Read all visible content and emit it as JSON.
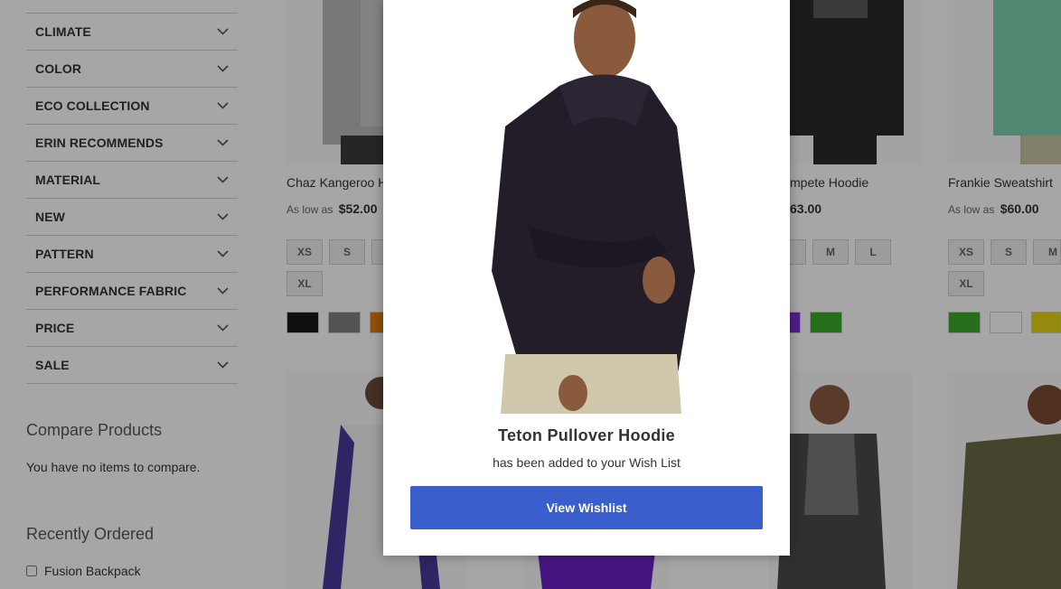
{
  "sidebar": {
    "filters": [
      {
        "label": "CLIMATE"
      },
      {
        "label": "COLOR"
      },
      {
        "label": "ECO COLLECTION"
      },
      {
        "label": "ERIN RECOMMENDS"
      },
      {
        "label": "MATERIAL"
      },
      {
        "label": "NEW"
      },
      {
        "label": "PATTERN"
      },
      {
        "label": "PERFORMANCE FABRIC"
      },
      {
        "label": "PRICE"
      },
      {
        "label": "SALE"
      }
    ],
    "compare": {
      "title": "Compare Products",
      "text": "You have no items to compare."
    },
    "recent": {
      "title": "Recently Ordered",
      "items": [
        {
          "label": "Fusion Backpack"
        }
      ]
    }
  },
  "products": [
    {
      "name": "Chaz Kangeroo H",
      "price_prefix": "As low as",
      "price": "$52.00",
      "sizes": [
        "XS",
        "S",
        "",
        "XL"
      ],
      "colors": [
        "#1a1a1a",
        "#808080",
        "#e07a10"
      ]
    },
    {
      "name": "mpete Hoodie",
      "price_prefix": "",
      "price": "63.00",
      "sizes": [
        "",
        "M",
        "L"
      ],
      "colors": [
        "#7a2ed6",
        "#3daa2a"
      ]
    },
    {
      "name": "Frankie Sweatshirt",
      "price_prefix": "As low as",
      "price": "$60.00",
      "sizes": [
        "XS",
        "S",
        "M",
        "XL"
      ],
      "colors": [
        "#3daa2a",
        "#ffffff",
        "#e3d414"
      ]
    }
  ],
  "modal": {
    "title": "Teton Pullover Hoodie",
    "subtitle": "has been added to your Wish List",
    "button": "View Wishlist",
    "button_color": "#3a5ecc"
  },
  "icons": {
    "filter_chevron": "chevron-down-icon"
  }
}
